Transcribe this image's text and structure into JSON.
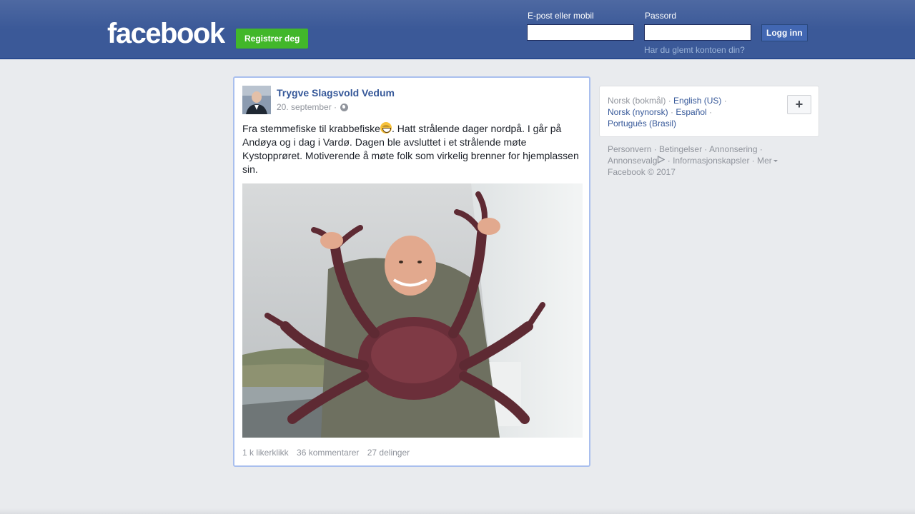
{
  "header": {
    "logo": "facebook",
    "register_label": "Registrer deg",
    "email_label": "E-post eller mobil",
    "email_value": "",
    "password_label": "Passord",
    "password_value": "",
    "login_label": "Logg inn",
    "forgot_label": "Har du glemt kontoen din?"
  },
  "post": {
    "author": "Trygve Slagsvold Vedum",
    "date": "20. september ·",
    "text_before_emoji": "Fra stemmefiske til krabbefiske",
    "text_after_emoji": ". Hatt strålende dager nordpå. I går på Andøya og i dag i Vardø. Dagen ble avsluttet i et strålende møte Kystopprøret. Motiverende å møte folk som virkelig brenner for hjemplassen sin.",
    "likes": "1 k likerklikk",
    "comments": "36 kommentarer",
    "shares": "27 delinger"
  },
  "languages": {
    "current": "Norsk (bokmål)",
    "options": [
      "English (US)",
      "Norsk (nynorsk)",
      "Español",
      "Português (Brasil)"
    ],
    "more_label": "+"
  },
  "footer": {
    "links": [
      "Personvern",
      "Betingelser",
      "Annonsering",
      "Annonsevalg",
      "Informasjonskapsler",
      "Mer"
    ],
    "copyright": "Facebook © 2017"
  },
  "colors": {
    "brand_blue": "#3b5998",
    "register_green": "#42b72a",
    "link_blue": "#365899"
  }
}
